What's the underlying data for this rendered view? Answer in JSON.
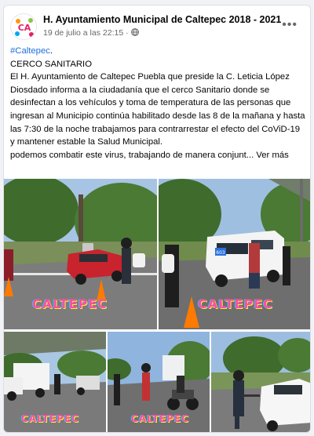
{
  "post": {
    "page_name": "H. Ayuntamiento Municipal de Caltepec 2018 - 2021",
    "date": "19 de julio a las 22:15",
    "dot": "·",
    "more": "•••",
    "avatar_text": "CA",
    "hashtag": "#Caltepec",
    "hashtag_suffix": ".",
    "heading": "CERCO SANITARIO",
    "body": "El H. Ayuntamiento de Caltepec Puebla que preside la C. Leticia López Diosdado informa a la ciudadanía que el cerco Sanitario donde se desinfectan a los vehículos y toma de temperatura de las personas que ingresan al Municipio continúa habilitado desde las 8 de la mañana y hasta las 7:30 de la noche trabajamos para contrarrestar el efecto del CoViD-19 y mantener estable la Salud Municipal.",
    "continued": " podemos combatir este virus, trabajando de manera conjunt...",
    "see_more": "Ver más"
  },
  "photos": {
    "watermark": "CALTEPEC",
    "plate": "603"
  },
  "colors": {
    "hashtag": "#216fdb",
    "watermark": "#ff4da6",
    "sky": "#9bb8d8"
  }
}
